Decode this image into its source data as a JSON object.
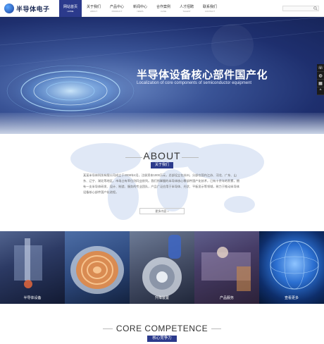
{
  "header": {
    "logo_text": "半导体电子",
    "nav": [
      {
        "cn": "网站首页",
        "en": "HOME",
        "active": true
      },
      {
        "cn": "关于我们",
        "en": "ABOUT",
        "active": false
      },
      {
        "cn": "产品中心",
        "en": "PRODUCT",
        "active": false
      },
      {
        "cn": "新闻中心",
        "en": "NEWS",
        "active": false
      },
      {
        "cn": "合作案例",
        "en": "CASE",
        "active": false
      },
      {
        "cn": "人才招聘",
        "en": "TALENT",
        "active": false
      },
      {
        "cn": "联系我们",
        "en": "CONTACT",
        "active": false
      }
    ]
  },
  "banner": {
    "title": "半导体设备核心部件国产化",
    "subtitle": "Localization of core components of semiconductor equipment"
  },
  "side_tools": [
    "phone-icon",
    "chat-icon",
    "qrcode-icon",
    "up-icon"
  ],
  "about": {
    "title": "ABOUT",
    "tag": "关于我们",
    "text": "某某半导体科技有限公司成立于2008年4月，注册资本1000万元，总部设立在苏州，分部在国内江苏、河北、广东、山东、辽宁、湖北等地区，市场占有率位列同业前列。我们所掌握的半导体核心零部件国产化技术，已有十余年的积累，拥有一支半导体研发、设计、制造、服务的专业团队，产品广泛应用于半导体、光伏、平板显示等领域，致力于推动半导体设备核心部件国产化进程。",
    "more": "更多内容 >"
  },
  "tiles": [
    {
      "label": "半导体设备",
      "icon": "semiconductor-equipment"
    },
    {
      "label": "",
      "icon": "wafer-heater"
    },
    {
      "label": "升降装置",
      "icon": "lift-device"
    },
    {
      "label": "产品服务",
      "icon": "product-service"
    },
    {
      "label": "查看更多",
      "icon": "globe"
    }
  ],
  "core": {
    "title": "CORE COMPETENCE",
    "tag": "核心竞争力"
  },
  "colors": {
    "brand": "#2b3a8c",
    "banner_dark": "#17255a"
  }
}
